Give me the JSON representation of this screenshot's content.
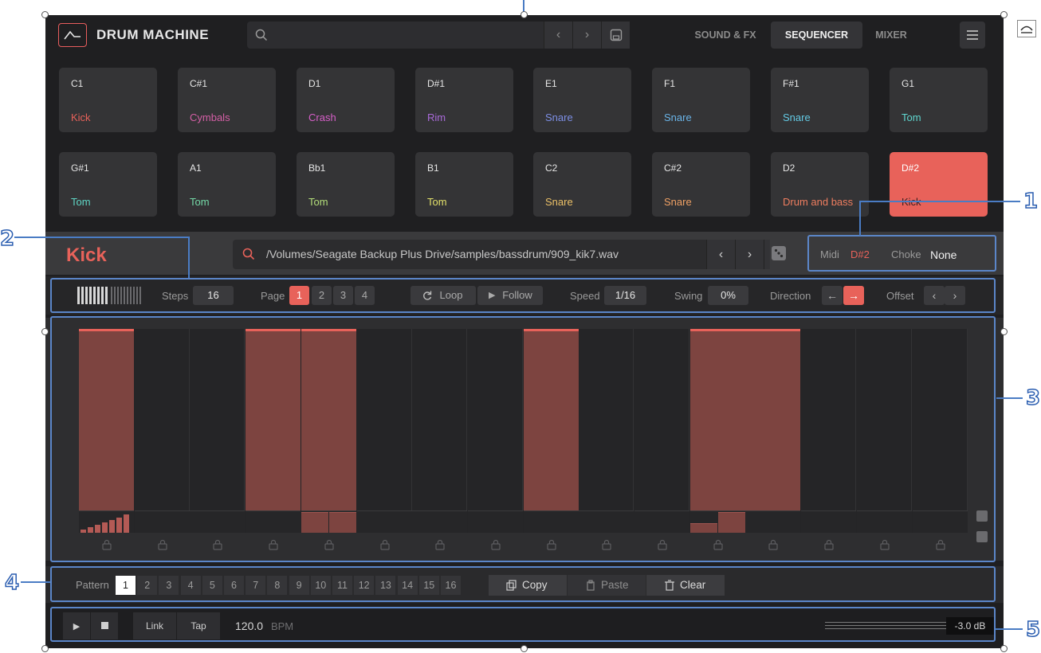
{
  "app": {
    "title": "DRUM MACHINE",
    "search_placeholder": "",
    "nav": [
      "SOUND & FX",
      "SEQUENCER",
      "MIXER"
    ],
    "active_nav": "SEQUENCER",
    "accent": "#e8625a"
  },
  "pads_row1": [
    {
      "note": "C1",
      "sample": "Kick",
      "color": "#e8625a"
    },
    {
      "note": "C#1",
      "sample": "Cymbals",
      "color": "#d45fa6"
    },
    {
      "note": "D1",
      "sample": "Crash",
      "color": "#d65fc8"
    },
    {
      "note": "D#1",
      "sample": "Rim",
      "color": "#a96ad8"
    },
    {
      "note": "E1",
      "sample": "Snare",
      "color": "#7d8fe6"
    },
    {
      "note": "F1",
      "sample": "Snare",
      "color": "#6ab4e8"
    },
    {
      "note": "F#1",
      "sample": "Snare",
      "color": "#63c9e3"
    },
    {
      "note": "G1",
      "sample": "Tom",
      "color": "#5fd6cf"
    }
  ],
  "pads_row2": [
    {
      "note": "G#1",
      "sample": "Tom",
      "color": "#5fd6c5"
    },
    {
      "note": "A1",
      "sample": "Tom",
      "color": "#74d9a7"
    },
    {
      "note": "Bb1",
      "sample": "Tom",
      "color": "#b3de7a"
    },
    {
      "note": "B1",
      "sample": "Tom",
      "color": "#e2e06a"
    },
    {
      "note": "C2",
      "sample": "Snare",
      "color": "#ebc067"
    },
    {
      "note": "C#2",
      "sample": "Snare",
      "color": "#eea064"
    },
    {
      "note": "D2",
      "sample": "Drum and bass",
      "color": "#ee7d5f"
    },
    {
      "note": "D#2",
      "sample": "Kick",
      "color": "#3a1f1f"
    }
  ],
  "instrument": {
    "name": "Kick",
    "path": "/Volumes/Seagate Backup Plus Drive/samples/bassdrum/909_kik7.wav",
    "midi_label": "Midi",
    "midi_value": "D#2",
    "choke_label": "Choke",
    "choke_value": "None"
  },
  "sequencer": {
    "steps_label": "Steps",
    "steps_value": "16",
    "page_label": "Page",
    "pages": [
      "1",
      "2",
      "3",
      "4"
    ],
    "loop_label": "Loop",
    "follow_label": "Follow",
    "speed_label": "Speed",
    "speed_value": "1/16",
    "swing_label": "Swing",
    "swing_value": "0%",
    "direction_label": "Direction",
    "offset_label": "Offset"
  },
  "steps_active": [
    1,
    0,
    0,
    1,
    1,
    0,
    0,
    0,
    1,
    0,
    0,
    1,
    1,
    0,
    0,
    0
  ],
  "patterns": {
    "label": "Pattern",
    "items": [
      "1",
      "2",
      "3",
      "4",
      "5",
      "6",
      "7",
      "8",
      "9",
      "10",
      "11",
      "12",
      "13",
      "14",
      "15",
      "16"
    ],
    "selected": "1",
    "copy": "Copy",
    "paste": "Paste",
    "clear": "Clear"
  },
  "transport": {
    "link": "Link",
    "tap": "Tap",
    "bpm_value": "120.0",
    "bpm_unit": "BPM",
    "level": "-3.0 dB"
  },
  "callouts": [
    "1",
    "2",
    "3",
    "4",
    "5"
  ]
}
